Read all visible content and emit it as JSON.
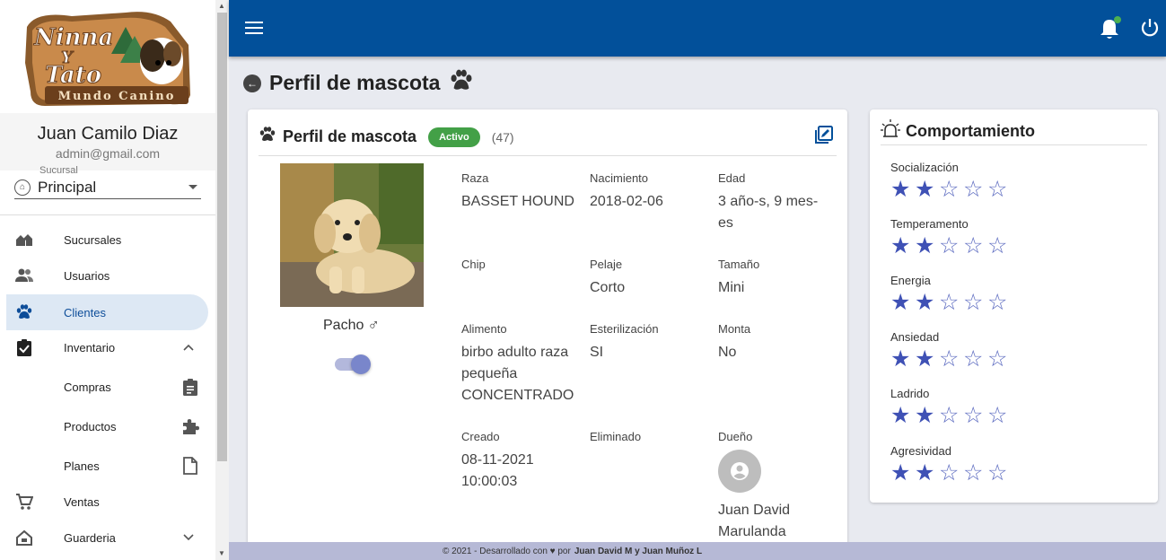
{
  "logo": {
    "line1": "Ninna",
    "line2": "Y",
    "line3": "Tato",
    "tagline": "Mundo Canino"
  },
  "user": {
    "name": "Juan Camilo Diaz",
    "email": "admin@gmail.com"
  },
  "branch": {
    "label": "Sucursal",
    "value": "Principal"
  },
  "nav": [
    {
      "label": "Sucursales",
      "icon": "home-group-icon"
    },
    {
      "label": "Usuarios",
      "icon": "users-icon"
    },
    {
      "label": "Clientes",
      "icon": "paw-icon",
      "active": true
    },
    {
      "label": "Inventario",
      "icon": "clipboard-check-icon",
      "expanded": true
    },
    {
      "label": "Compras",
      "icon": "clipboard-icon",
      "sub": true
    },
    {
      "label": "Productos",
      "icon": "puzzle-icon",
      "sub": true
    },
    {
      "label": "Planes",
      "icon": "document-icon",
      "sub": true
    },
    {
      "label": "Ventas",
      "icon": "cart-icon"
    },
    {
      "label": "Guarderia",
      "icon": "house-icon",
      "expanded": false
    }
  ],
  "page": {
    "title": "Perfil de mascota"
  },
  "pet_card": {
    "title": "Perfil de mascota",
    "status": "Activo",
    "count": "(47)",
    "pet_name": "Pacho",
    "gender_symbol": "♂",
    "fields": {
      "raza": {
        "label": "Raza",
        "value": "BASSET HOUND"
      },
      "nacimiento": {
        "label": "Nacimiento",
        "value": "2018-02-06"
      },
      "edad": {
        "label": "Edad",
        "value": "3 año-s, 9 mes-es"
      },
      "chip": {
        "label": "Chip",
        "value": ""
      },
      "pelaje": {
        "label": "Pelaje",
        "value": "Corto"
      },
      "tamano": {
        "label": "Tamaño",
        "value": "Mini"
      },
      "alimento": {
        "label": "Alimento",
        "value": "birbo adulto raza pequeña CONCENTRADO"
      },
      "esterilizacion": {
        "label": "Esterilización",
        "value": "SI"
      },
      "monta": {
        "label": "Monta",
        "value": "No"
      },
      "creado": {
        "label": "Creado",
        "value": "08-11-2021 10:00:03"
      },
      "eliminado": {
        "label": "Eliminado",
        "value": ""
      },
      "dueno": {
        "label": "Dueño",
        "value": "Juan David Marulanda"
      }
    }
  },
  "behavior": {
    "title": "Comportamiento",
    "traits": [
      {
        "label": "Socialización",
        "rating": 2,
        "max": 5
      },
      {
        "label": "Temperamento",
        "rating": 2,
        "max": 5
      },
      {
        "label": "Energia",
        "rating": 2,
        "max": 5
      },
      {
        "label": "Ansiedad",
        "rating": 2,
        "max": 5
      },
      {
        "label": "Ladrido",
        "rating": 2,
        "max": 5
      },
      {
        "label": "Agresividad",
        "rating": 2,
        "max": 5
      }
    ]
  },
  "footer": {
    "text": "© 2021 -  Desarrollado con ♥ por",
    "authors": "Juan David M y Juan Muñoz L"
  }
}
